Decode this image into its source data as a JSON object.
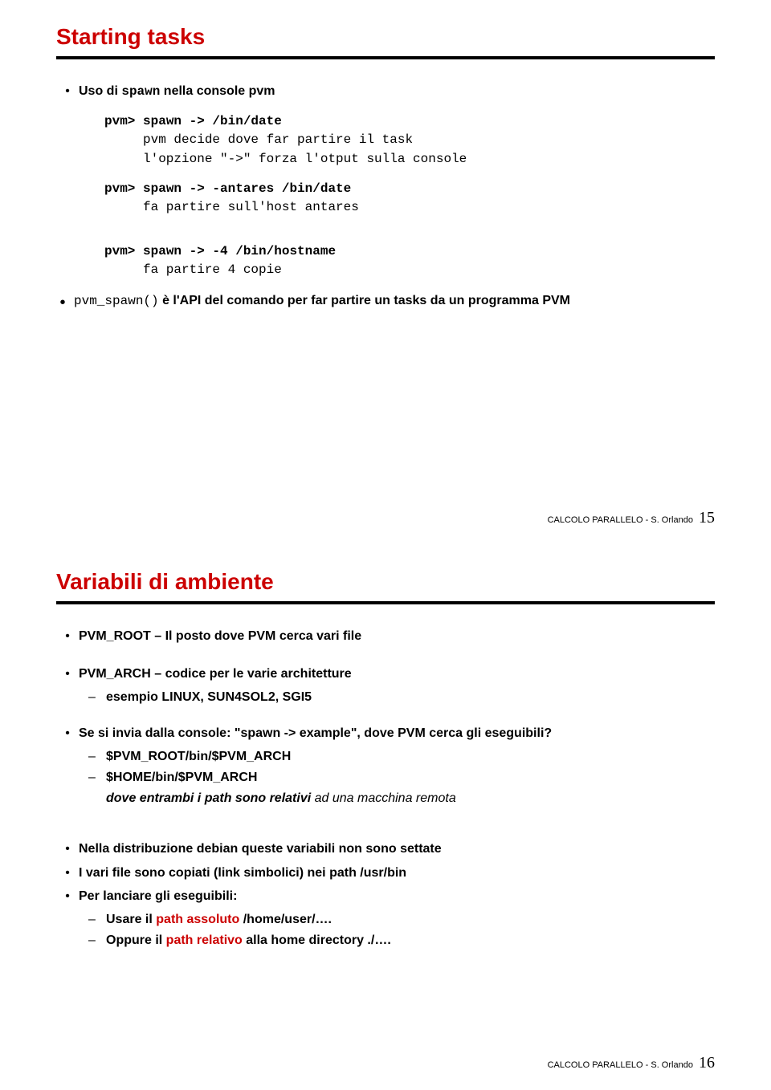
{
  "slides": [
    {
      "title": "Starting tasks",
      "footer_label": "CALCOLO PARALLELO - S. Orlando",
      "page": "15",
      "b1_pre": "Uso di ",
      "b1_code": "spawn",
      "b1_post": " nella console pvm",
      "code1_l1": "pvm> spawn -> /bin/date",
      "code1_l2a": "pvm decide dove far partire il task",
      "code1_l2b": "l'opzione \"->\" forza l'otput sulla console",
      "code2_l1": "pvm> spawn -> -antares /bin/date",
      "code2_l2": "fa partire sull'host antares",
      "code3_l1": "pvm> spawn -> -4 /bin/hostname",
      "code3_l2": "fa partire 4 copie",
      "b2_code": "pvm_spawn()",
      "b2_text": " è l'API del comando per far partire un tasks da un programma PVM"
    },
    {
      "title": "Variabili di ambiente",
      "footer_label": "CALCOLO PARALLELO - S. Orlando",
      "page": "16",
      "b1": "PVM_ROOT – Il posto dove PVM cerca vari file",
      "b2": "PVM_ARCH – codice per le varie architetture",
      "b2_s1": "esempio LINUX, SUN4SOL2, SGI5",
      "b3": "Se si invia dalla console: \"spawn -> example\", dove PVM cerca gli eseguibili?",
      "b3_s1": "$PVM_ROOT/bin/$PVM_ARCH",
      "b3_s2": "$HOME/bin/$PVM_ARCH",
      "b3_note_pre": "dove entrambi i path sono relativi",
      "b3_note_post": " ad una macchina remota",
      "b4": "Nella distribuzione debian queste variabili non sono settate",
      "b5": "I vari file sono copiati (link simbolici) nei path /usr/bin",
      "b6": "Per lanciare gli eseguibili:",
      "b6_s1_pre": "Usare il ",
      "b6_s1_red": "path assoluto",
      "b6_s1_post": " /home/user/….",
      "b6_s2_pre": "Oppure il ",
      "b6_s2_red": "path relativo",
      "b6_s2_post": " alla home directory  ./…."
    }
  ]
}
